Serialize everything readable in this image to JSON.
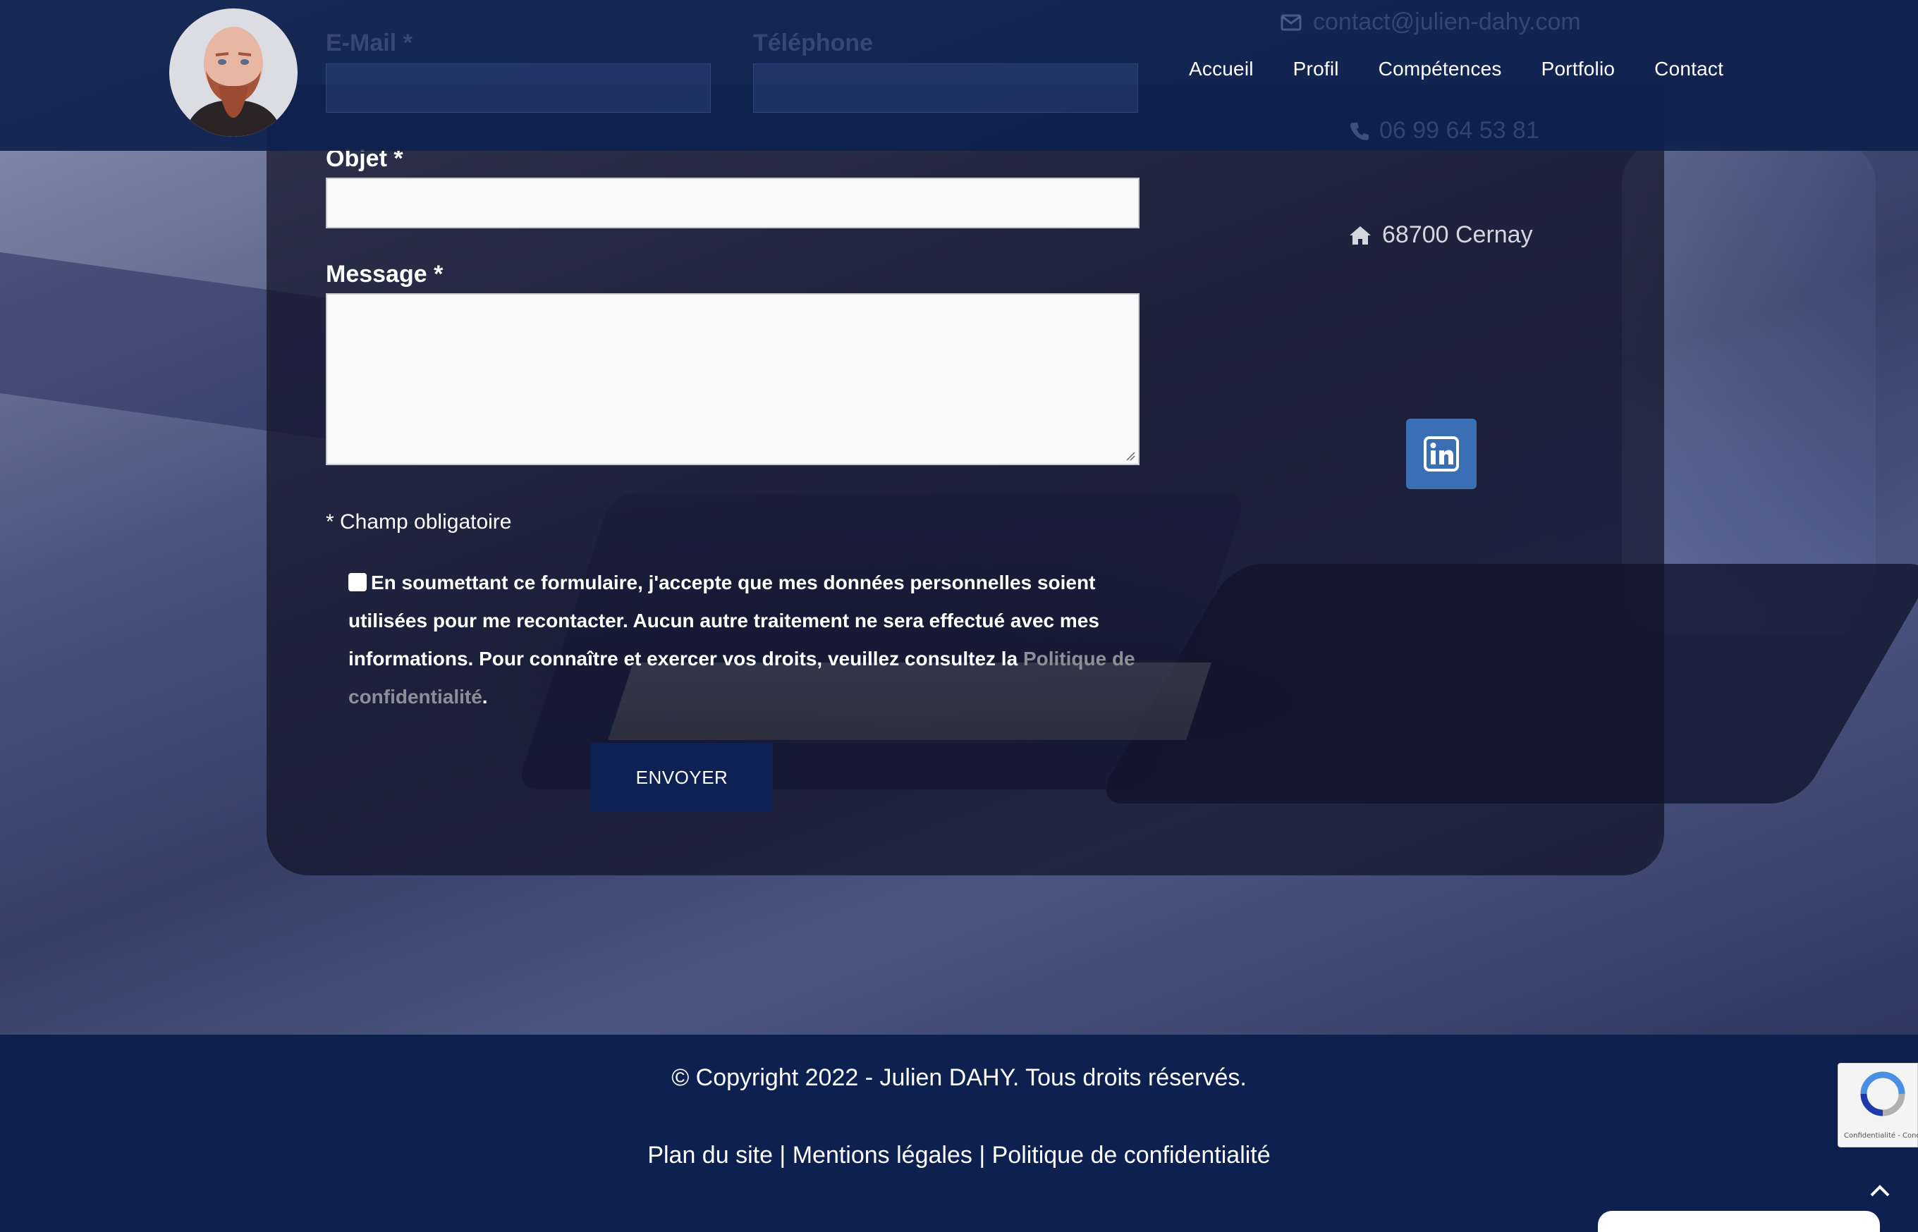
{
  "header": {
    "nav": [
      "Accueil",
      "Profil",
      "Compétences",
      "Portfolio",
      "Contact"
    ],
    "faded_email_label": "E-Mail *",
    "faded_phone_label": "Téléphone",
    "faded_contact_email": "contact@julien-dahy.com",
    "faded_contact_phone": "06 99 64 53 81"
  },
  "form": {
    "subject_label": "Objet *",
    "message_label": "Message *",
    "subject_value": "",
    "message_value": "",
    "required_note": "* Champ obligatoire",
    "consent_text": "En soumettant ce formulaire, j'accepte que mes données personnelles soient utilisées pour me recontacter. Aucun autre traitement ne sera effectué avec mes informations. Pour connaître et exercer vos droits, veuillez consultez la ",
    "consent_link": "Politique de confidentialité",
    "consent_end": ".",
    "submit_label": "ENVOYER"
  },
  "contact": {
    "address": "68700 Cernay",
    "linkedin_icon": "linkedin-icon"
  },
  "footer": {
    "copyright": "© Copyright 2022 - Julien DAHY. Tous droits réservés.",
    "links": [
      "Plan du site",
      "Mentions légales",
      "Politique de confidentialité"
    ],
    "separator": " | "
  },
  "recaptcha": {
    "text": "Confidentialité - Conditions"
  },
  "colors": {
    "header_bg": "#0e204e",
    "footer_bg": "#0d2050",
    "button_bg": "#0d2154",
    "linkedin_bg": "#3a6fb4"
  }
}
